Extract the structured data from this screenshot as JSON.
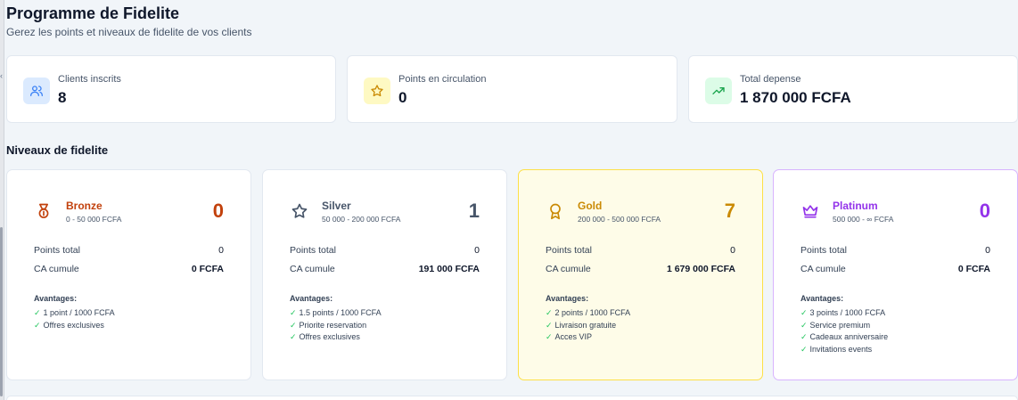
{
  "header": {
    "title": "Programme de Fidelite",
    "subtitle": "Gerez les points et niveaux de fidelite de vos clients"
  },
  "stats": [
    {
      "label": "Clients inscrits",
      "value": "8",
      "icon": "users-icon",
      "icon_color": "#3b82f6",
      "icon_bg": "#dbeafe"
    },
    {
      "label": "Points en circulation",
      "value": "0",
      "icon": "star-icon",
      "icon_color": "#ca8a04",
      "icon_bg": "#fef9c3"
    },
    {
      "label": "Total depense",
      "value": "1 870 000 FCFA",
      "icon": "trending-up-icon",
      "icon_color": "#16a34a",
      "icon_bg": "#dcfce7"
    }
  ],
  "tiers_section": {
    "title": "Niveaux de fidelite",
    "points_label": "Points total",
    "ca_label": "CA cumule",
    "advantages_label": "Avantages:"
  },
  "tiers": [
    {
      "name": "Bronze",
      "range": "0 - 50 000 FCFA",
      "count": "0",
      "points": "0",
      "ca": "0 FCFA",
      "color": "#c2410c",
      "icon": "medal-icon",
      "advantages": [
        "1 point / 1000 FCFA",
        "Offres exclusives"
      ]
    },
    {
      "name": "Silver",
      "range": "50 000 - 200 000 FCFA",
      "count": "1",
      "points": "0",
      "ca": "191 000 FCFA",
      "color": "#475569",
      "icon": "star-outline-icon",
      "advantages": [
        "1.5 points / 1000 FCFA",
        "Priorite reservation",
        "Offres exclusives"
      ]
    },
    {
      "name": "Gold",
      "range": "200 000 - 500 000 FCFA",
      "count": "7",
      "points": "0",
      "ca": "1 679 000 FCFA",
      "color": "#ca8a04",
      "icon": "award-icon",
      "advantages": [
        "2 points / 1000 FCFA",
        "Livraison gratuite",
        "Acces VIP"
      ]
    },
    {
      "name": "Platinum",
      "range": "500 000 - ∞ FCFA",
      "count": "0",
      "points": "0",
      "ca": "0 FCFA",
      "color": "#9333ea",
      "icon": "crown-icon",
      "advantages": [
        "3 points / 1000 FCFA",
        "Service premium",
        "Cadeaux anniversaire",
        "Invitations events"
      ]
    }
  ],
  "check_glyph": "✓"
}
